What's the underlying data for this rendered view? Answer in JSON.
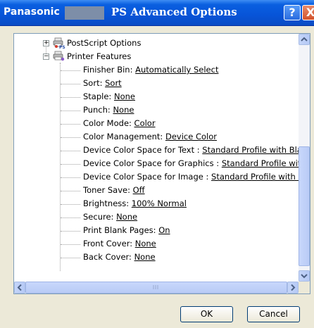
{
  "window": {
    "title_prefix": "Panasonic",
    "title_suffix": "PS Advanced Options",
    "help_label": "?",
    "close_label": "X"
  },
  "tree": {
    "postscript_label": "PostScript Options",
    "printer_features_label": "Printer Features",
    "features": [
      {
        "label": "Finisher Bin: ",
        "value": "Automatically Select"
      },
      {
        "label": "Sort: ",
        "value": "Sort"
      },
      {
        "label": "Staple: ",
        "value": "None"
      },
      {
        "label": "Punch: ",
        "value": "None"
      },
      {
        "label": "Color Mode: ",
        "value": "Color"
      },
      {
        "label": "Color Management: ",
        "value": "Device Color"
      },
      {
        "label": "Device Color Space for Text : ",
        "value": "Standard Profile with Black"
      },
      {
        "label": "Device Color Space for Graphics : ",
        "value": "Standard Profile with E"
      },
      {
        "label": "Device Color Space for Image : ",
        "value": "Standard Profile with CM"
      },
      {
        "label": "Toner Save: ",
        "value": "Off"
      },
      {
        "label": "Brightness: ",
        "value": "100% Normal"
      },
      {
        "label": "Secure: ",
        "value": "None"
      },
      {
        "label": "Print Blank Pages: ",
        "value": "On"
      },
      {
        "label": "Front Cover: ",
        "value": "None"
      },
      {
        "label": "Back Cover: ",
        "value": "None"
      }
    ]
  },
  "buttons": {
    "ok_label": "OK",
    "cancel_label": "Cancel"
  },
  "icons": {
    "expand": "plus-box",
    "collapse": "minus-box",
    "scroll_up": "up-arrow",
    "scroll_down": "down-arrow",
    "scroll_left": "left-arrow",
    "scroll_right": "right-arrow"
  },
  "colors": {
    "titlebar": "#0754d8",
    "face": "#ece9d8",
    "tree_border": "#7f9db9",
    "scroll_thumb": "#c1d3fb"
  },
  "scroll": {
    "vertical_position": 0.45,
    "horizontal_position": 0.0
  }
}
